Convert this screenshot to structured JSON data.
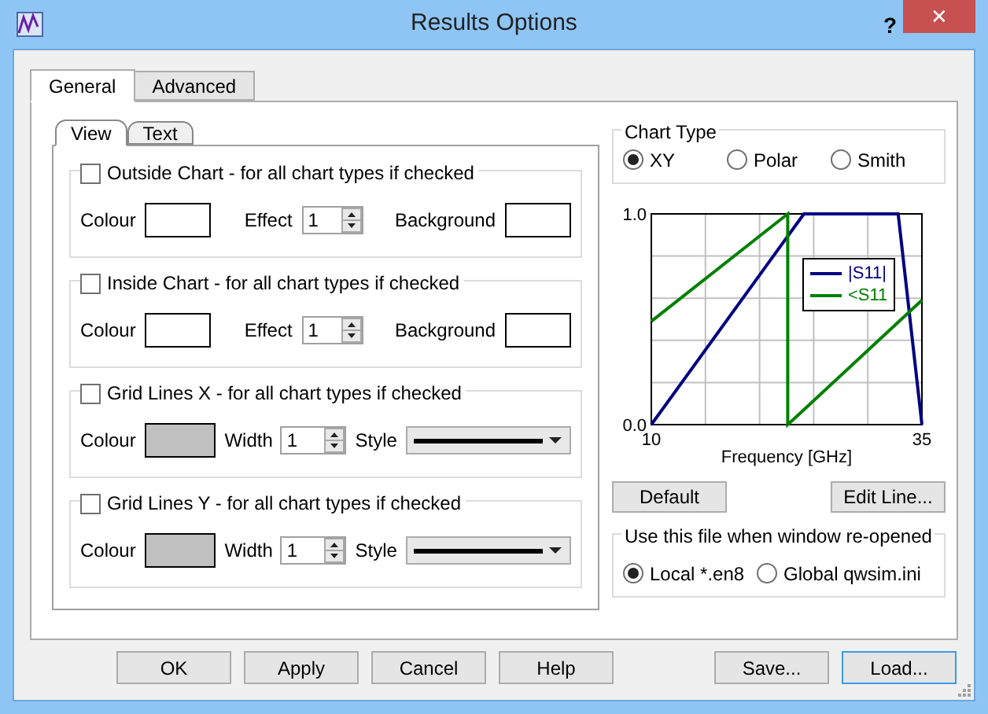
{
  "window": {
    "title": "Results Options",
    "help": "?",
    "close": "✕"
  },
  "tabs": [
    {
      "label": "General",
      "selected": true
    },
    {
      "label": "Advanced",
      "selected": false
    }
  ],
  "subtabs": [
    {
      "label": "View",
      "selected": true
    },
    {
      "label": "Text",
      "selected": false
    }
  ],
  "groups": [
    {
      "kind": "effect",
      "label": "Outside Chart - for all chart types if checked",
      "checked": false,
      "colour_label": "Colour",
      "effect_label": "Effect",
      "effect_value": "1",
      "background_label": "Background"
    },
    {
      "kind": "effect",
      "label": "Inside Chart - for all chart types if checked",
      "checked": false,
      "colour_label": "Colour",
      "effect_label": "Effect",
      "effect_value": "1",
      "background_label": "Background"
    },
    {
      "kind": "grid",
      "label": "Grid Lines X - for all chart types if checked",
      "checked": false,
      "colour_label": "Colour",
      "width_label": "Width",
      "width_value": "1",
      "style_label": "Style"
    },
    {
      "kind": "grid",
      "label": "Grid Lines Y - for all chart types if checked",
      "checked": false,
      "colour_label": "Colour",
      "width_label": "Width",
      "width_value": "1",
      "style_label": "Style"
    }
  ],
  "chart_type": {
    "title": "Chart Type",
    "options": [
      {
        "label": "XY",
        "selected": true
      },
      {
        "label": "Polar",
        "selected": false
      },
      {
        "label": "Smith",
        "selected": false
      }
    ]
  },
  "preview": {
    "chart_data": {
      "type": "line",
      "legend": true,
      "xlabel": "Frequency [GHz]",
      "x": [
        10,
        22.6,
        22.6,
        24.1,
        32.8,
        35
      ],
      "xlim": [
        10,
        35
      ],
      "ylim": [
        0,
        1
      ],
      "xticks": [
        10,
        35
      ],
      "yticks": [
        {
          "value": 0,
          "label": "0.0"
        },
        {
          "value": 1,
          "label": "1.0"
        }
      ],
      "series": [
        {
          "name": "|S11|",
          "color": "#000080",
          "values": [
            0,
            0.894,
            0.894,
            1,
            1,
            0
          ]
        },
        {
          "name": "<S11",
          "color": "#008000",
          "values": [
            0.49,
            1,
            0,
            0.071,
            0.486,
            0.59
          ]
        }
      ]
    }
  },
  "chart_buttons": [
    "Default",
    "Edit Line..."
  ],
  "file_group": {
    "title": "Use this file when window re-opened",
    "options": [
      {
        "label": "Local *.en8",
        "selected": true
      },
      {
        "label": "Global qwsim.ini",
        "selected": false
      }
    ]
  },
  "footer_buttons": [
    {
      "label": "OK",
      "focused": false
    },
    {
      "label": "Apply",
      "focused": false
    },
    {
      "label": "Cancel",
      "focused": false
    },
    {
      "label": "Help",
      "focused": false
    },
    {
      "label": "Save...",
      "focused": false
    },
    {
      "label": "Load...",
      "focused": true
    }
  ]
}
